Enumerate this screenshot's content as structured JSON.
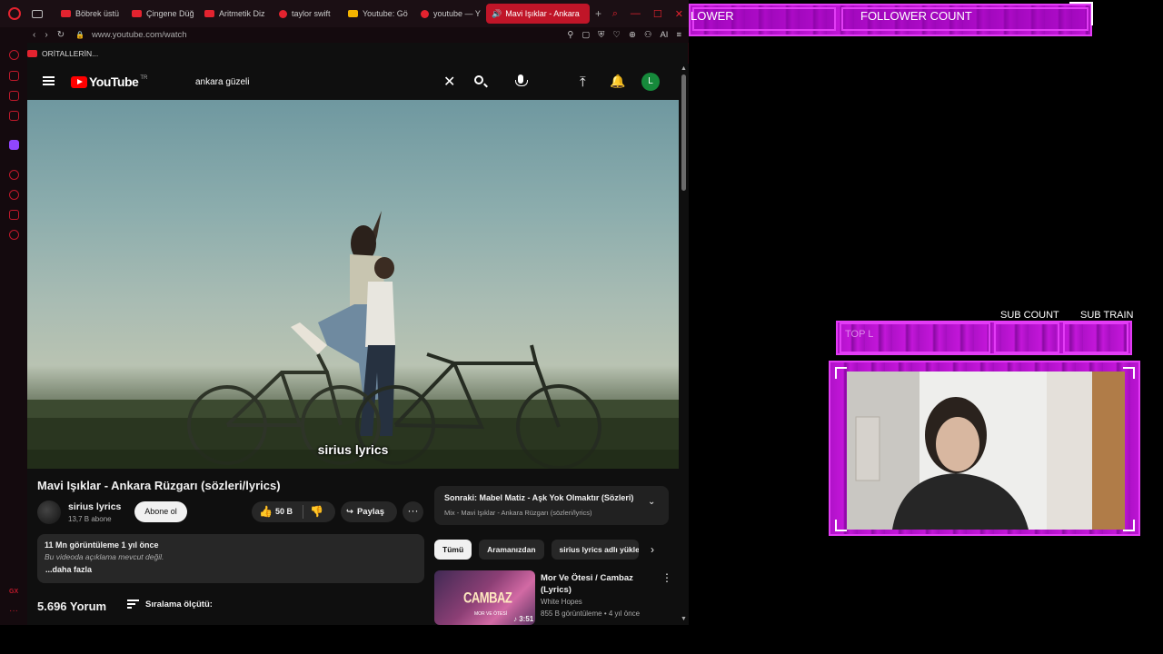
{
  "browser": {
    "tabs": [
      {
        "label": "Böbrek üstü",
        "icon": "youtube-icon"
      },
      {
        "label": "Çingene Düğ",
        "icon": "youtube-icon"
      },
      {
        "label": "Aritmetik Diz",
        "icon": "youtube-icon"
      },
      {
        "label": "taylor swift",
        "icon": "yandex-icon"
      },
      {
        "label": "Youtube: Gö",
        "icon": "folder-icon"
      },
      {
        "label": "youtube — Y",
        "icon": "yandex-icon"
      },
      {
        "label": "Mavi Işıklar - Ankara",
        "icon": "speaker-icon",
        "active": true
      }
    ],
    "url": "www.youtube.com/watch",
    "bookmark": "ORİTALLERİN...",
    "ai_label": "AI",
    "accent": "#c01528"
  },
  "youtube": {
    "logo_text": "YouTube",
    "region": "TR",
    "search_value": "ankara güzeli",
    "avatar_letter": "L",
    "caption": "sirius lyrics",
    "video": {
      "title": "Mavi Işıklar - Ankara Rüzgarı (sözleri/lyrics)",
      "channel": "sirius lyrics",
      "subscribers": "13,7 B abone",
      "subscribe_label": "Abone ol",
      "likes": "50 B",
      "share_label": "Paylaş",
      "description": {
        "meta": "11 Mn görüntüleme  1 yıl önce",
        "text": "Bu videoda açıklama mevcut değil.",
        "more": "...daha fazla"
      },
      "comments_count": "5.696 Yorum",
      "sort_label": "Sıralama ölçütü:"
    },
    "up_next": {
      "title": "Sonraki: Mabel Matiz - Aşk Yok Olmaktır (Sözleri)",
      "subtitle": "Mix - Mavi Işıklar - Ankara Rüzgarı (sözleri/lyrics)"
    },
    "chips": [
      "Tümü",
      "Aramanızdan",
      "sirius lyrics adlı yükleyiciden"
    ],
    "recommendation": {
      "thumb_text": "CAMBAZ",
      "thumb_sub": "MOR VE ÖTESİ",
      "duration": "3:51",
      "title": "Mor Ve Ötesi / Cambaz (Lyrics)",
      "channel": "White Hopes",
      "meta": "855 B görüntüleme • 4 yıl önce"
    }
  },
  "overlay": {
    "follower_label": "LOWER",
    "follower_count_label": "FOLLOWER COUNT",
    "sub_count_label": "SUB COUNT",
    "sub_train_label": "SUB TRAIN",
    "top_label": "TOP L",
    "frame_color": "#c316d9"
  }
}
